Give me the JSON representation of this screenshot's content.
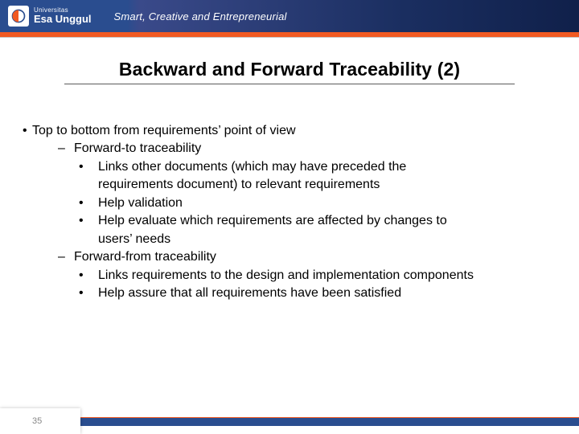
{
  "header": {
    "logo_small": "Universitas",
    "logo_main": "Esa Unggul",
    "tagline": "Smart, Creative and Entrepreneurial"
  },
  "title": "Backward and Forward Traceability (2)",
  "content": {
    "l1": "Top to bottom from requirements’ point of view",
    "section_a": {
      "heading": "Forward-to traceability",
      "items": [
        "Links other documents (which may have preceded the requirements document) to relevant requirements",
        "Help validation",
        "Help evaluate which requirements are affected by changes to users’ needs"
      ],
      "items_line1": {
        "0": "Links other documents (which may have preceded the",
        "2": "Help evaluate which requirements are affected by changes to"
      },
      "items_line2": {
        "0": "requirements document) to relevant requirements",
        "2": "users’ needs"
      }
    },
    "section_b": {
      "heading": "Forward-from traceability",
      "items": [
        "Links requirements to the design and implementation components",
        "Help assure that all requirements have been satisfied"
      ]
    }
  },
  "page_number": "35"
}
